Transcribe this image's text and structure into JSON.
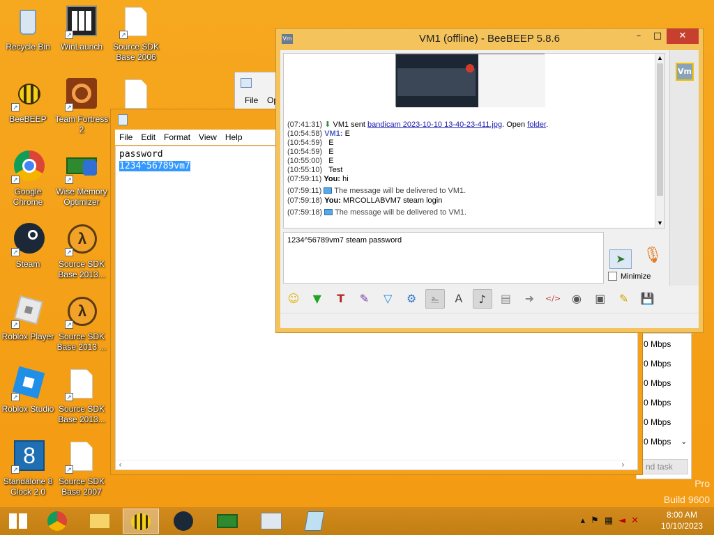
{
  "desktop": {
    "icons": [
      {
        "label": "Recycle Bin"
      },
      {
        "label": "WinLaunch"
      },
      {
        "label": "Source SDK Base 2006"
      },
      {
        "label": "BeeBEEP"
      },
      {
        "label": "Team Fortress 2"
      },
      {
        "label": "Google Chrome"
      },
      {
        "label": "Wise Memory Optimizer"
      },
      {
        "label": "Steam"
      },
      {
        "label": "Source SDK Base 2013..."
      },
      {
        "label": "Roblox Player"
      },
      {
        "label": "Source SDK Base 2013 ..."
      },
      {
        "label": "Roblox Studio"
      },
      {
        "label": "Source SDK Base 2013..."
      },
      {
        "label": "Standalone 8 Clock 2.0"
      },
      {
        "label": "Source SDK Base 2007"
      }
    ],
    "watermark_edition": "Pro",
    "watermark_build": "Build 9600"
  },
  "paint_window": {
    "menu_file": "File",
    "menu_op": "Op"
  },
  "notepad": {
    "menu": [
      "File",
      "Edit",
      "Format",
      "View",
      "Help"
    ],
    "line1": "password",
    "line2_selected": "1234^56789vm7"
  },
  "task_manager": {
    "network_values": [
      "0 Mbps",
      "0 Mbps",
      "0 Mbps",
      "0 Mbps",
      "0 Mbps",
      "0 Mbps"
    ],
    "end_task_label": "nd task"
  },
  "beebeep": {
    "title": "VM1 (offline) - BeeBEEP 5.8.6",
    "app_badge": "Vm",
    "chat": {
      "file_ts": "(07:41:31)",
      "file_sender": "VM1 sent",
      "file_name": "bandicam 2023-10-10 13-40-23-411.jpg",
      "file_open": ". Open",
      "file_folder": "folder",
      "file_end": ".",
      "messages": [
        {
          "ts": "(10:54:58)",
          "sender": "VM1:",
          "text": "E"
        },
        {
          "ts": "(10:54:59)",
          "sender": "",
          "text": "E"
        },
        {
          "ts": "(10:54:59)",
          "sender": "",
          "text": "E"
        },
        {
          "ts": "(10:55:00)",
          "sender": "",
          "text": "E"
        },
        {
          "ts": "(10:55:10)",
          "sender": "",
          "text": "Test"
        },
        {
          "ts": "(07:59:11)",
          "sender": "You:",
          "text": "hi"
        },
        {
          "ts": "(07:59:11)",
          "sender": "",
          "text": "The message will be delivered to VM1."
        },
        {
          "ts": "(07:59:18)",
          "sender": "You:",
          "text": "MRCOLLABVM7 steam login"
        },
        {
          "ts": "(07:59:18)",
          "sender": "",
          "text": "The message will be delivered to VM1."
        }
      ]
    },
    "input_text": "1234^56789vm7 steam password",
    "minimize_label": "Minimize",
    "user_avatar": "Vm"
  },
  "taskbar": {
    "time": "8:00 AM",
    "date": "10/10/2023"
  }
}
